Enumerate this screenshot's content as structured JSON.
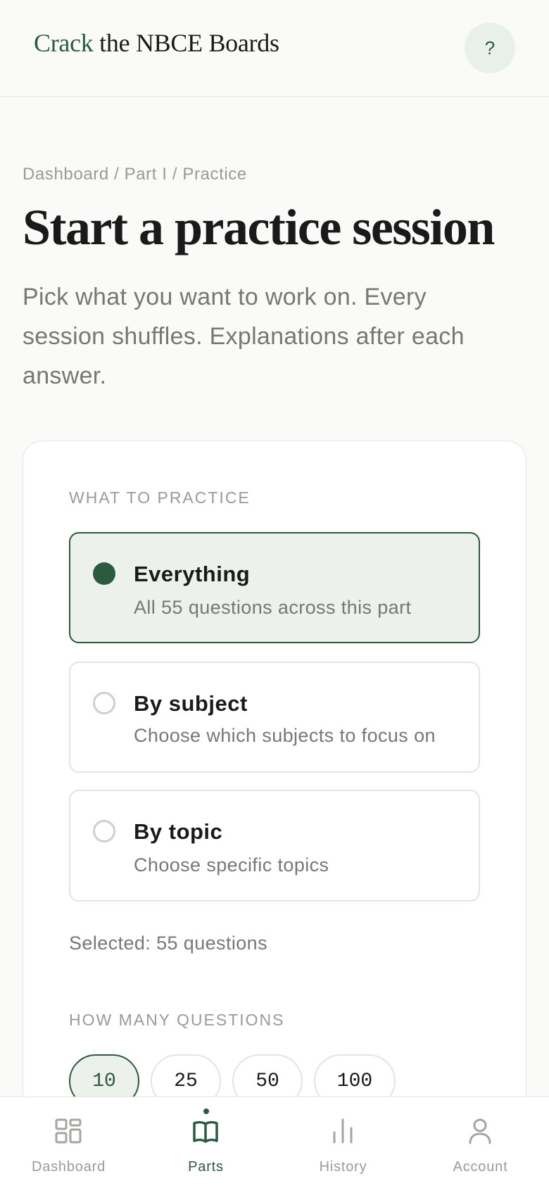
{
  "header": {
    "brand_accent": "Crack",
    "brand_rest": " the NBCE Boards",
    "help_label": "?"
  },
  "breadcrumb": "Dashboard / Part I / Practice",
  "page_title": "Start a practice session",
  "subtitle": "Pick what you want to work on. Every session shuffles. Explanations after each answer.",
  "practice": {
    "section_label": "WHAT TO PRACTICE",
    "options": [
      {
        "title": "Everything",
        "desc": "All 55 questions across this part",
        "selected": true
      },
      {
        "title": "By subject",
        "desc": "Choose which subjects to focus on",
        "selected": false
      },
      {
        "title": "By topic",
        "desc": "Choose specific topics",
        "selected": false
      }
    ],
    "selected_count": "Selected: 55 questions"
  },
  "quantity": {
    "section_label": "HOW MANY QUESTIONS",
    "options": [
      "10",
      "25",
      "50",
      "100"
    ],
    "selected": "10"
  },
  "nav": {
    "items": [
      {
        "label": "Dashboard",
        "icon": "dashboard-icon",
        "active": false
      },
      {
        "label": "Parts",
        "icon": "book-icon",
        "active": true
      },
      {
        "label": "History",
        "icon": "bar-chart-icon",
        "active": false
      },
      {
        "label": "Account",
        "icon": "user-icon",
        "active": false
      }
    ]
  },
  "colors": {
    "accent": "#2c5a3e",
    "accent_light": "#ecf1ec",
    "background": "#fafaf8"
  }
}
